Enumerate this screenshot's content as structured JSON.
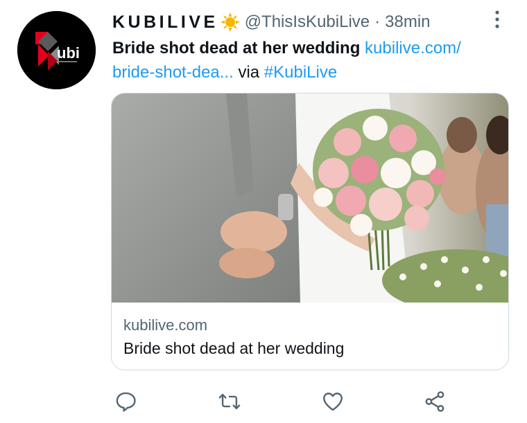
{
  "tweet": {
    "author": {
      "display_name": "KUBILIVE",
      "handle": "@ThisIsKubiLive",
      "avatar_text": "ubi",
      "verified_icon": "sun-badge-icon"
    },
    "separator": "·",
    "time": "38min",
    "text": {
      "headline": "Bride shot dead at her wedding",
      "link_part1": "kubilive.com/",
      "link_part2": "bride-shot-dea...",
      "via": "via",
      "hashtag": "#KubiLive"
    },
    "card": {
      "domain": "kubilive.com",
      "title": "Bride shot dead at her wedding",
      "image": "wedding-bouquet-photo"
    },
    "actions": [
      {
        "name": "reply",
        "icon": "reply-icon"
      },
      {
        "name": "retweet",
        "icon": "retweet-icon"
      },
      {
        "name": "like",
        "icon": "heart-icon"
      },
      {
        "name": "share",
        "icon": "share-icon"
      }
    ]
  },
  "colors": {
    "link": "#1d9bf0",
    "secondary": "#536471",
    "border": "#cfd9de",
    "brand_red": "#e3001b",
    "sun": "#f7b500"
  }
}
